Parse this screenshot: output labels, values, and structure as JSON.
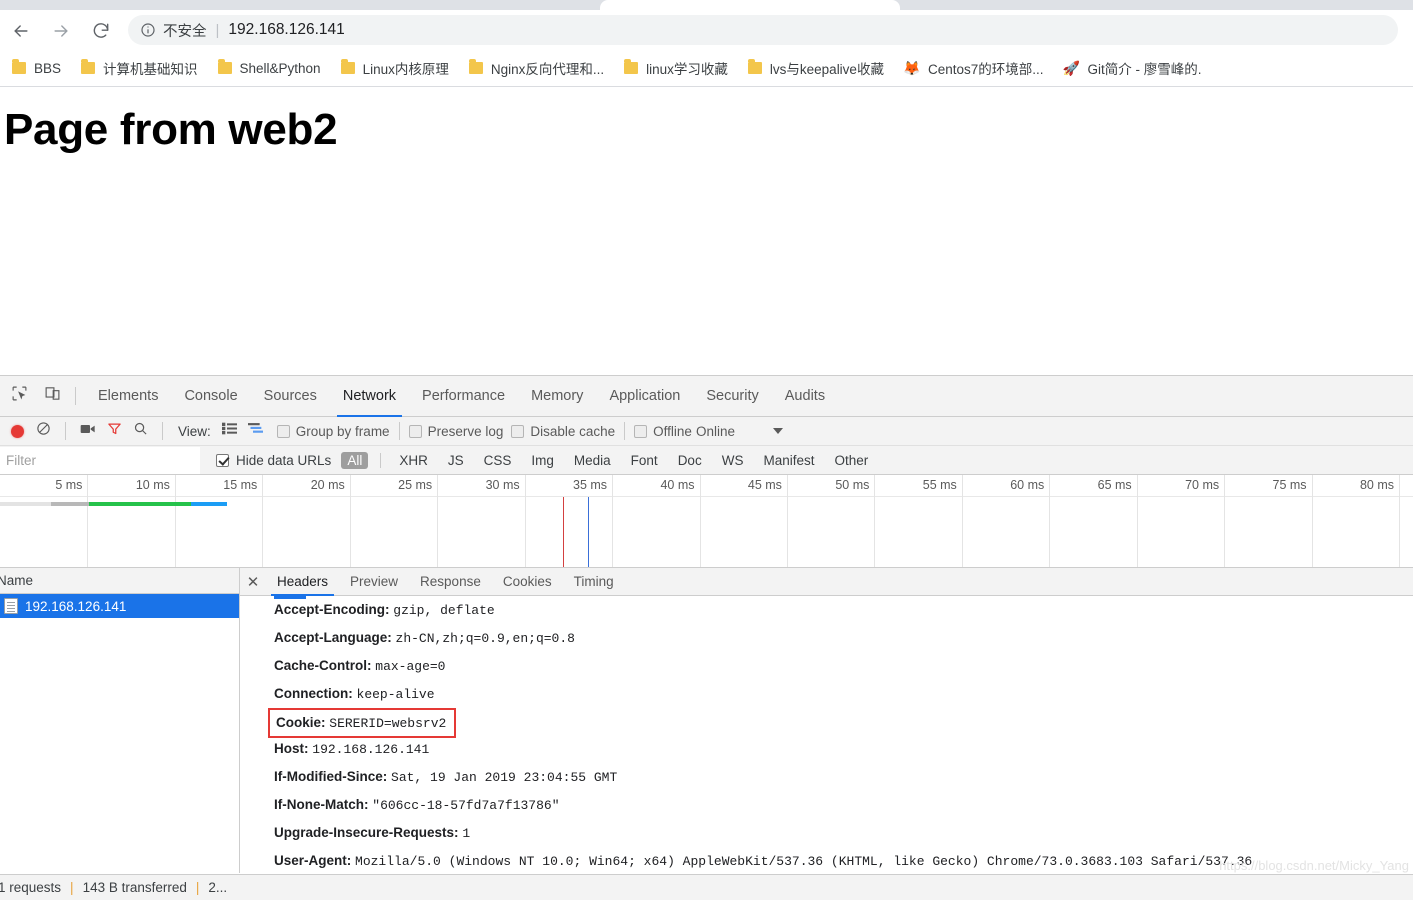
{
  "browser": {
    "nav": {
      "back_icon": "arrow-left-icon",
      "forward_icon": "arrow-right-icon",
      "reload_icon": "reload-icon"
    },
    "omnibox": {
      "info_icon": "info-circle-icon",
      "security_label": "不安全",
      "separator": "|",
      "url": "192.168.126.141"
    },
    "bookmarks": [
      {
        "label": "BBS",
        "icon": "folder-icon"
      },
      {
        "label": "计算机基础知识",
        "icon": "folder-icon"
      },
      {
        "label": "Shell&Python",
        "icon": "folder-icon"
      },
      {
        "label": "Linux内核原理",
        "icon": "folder-icon"
      },
      {
        "label": "Nginx反向代理和...",
        "icon": "folder-icon"
      },
      {
        "label": "linux学习收藏",
        "icon": "folder-icon"
      },
      {
        "label": "lvs与keepalive收藏",
        "icon": "folder-icon"
      },
      {
        "label": "Centos7的环境部...",
        "icon": "fox-icon"
      },
      {
        "label": "Git简介 - 廖雪峰的.",
        "icon": "rocket-icon"
      }
    ]
  },
  "page": {
    "heading": "Page from web2"
  },
  "devtools": {
    "left_icons": [
      {
        "name": "inspect-element-icon"
      },
      {
        "name": "device-toolbar-icon"
      }
    ],
    "tabs": [
      {
        "label": "Elements",
        "active": false
      },
      {
        "label": "Console",
        "active": false
      },
      {
        "label": "Sources",
        "active": false
      },
      {
        "label": "Network",
        "active": true
      },
      {
        "label": "Performance",
        "active": false
      },
      {
        "label": "Memory",
        "active": false
      },
      {
        "label": "Application",
        "active": false
      },
      {
        "label": "Security",
        "active": false
      },
      {
        "label": "Audits",
        "active": false
      }
    ],
    "toolbar": {
      "record_icon": "record-button-icon",
      "clear_icon": "clear-icon",
      "capture_screenshots_icon": "camera-icon",
      "filter_icon": "funnel-icon",
      "search_icon": "search-icon",
      "view_label": "View:",
      "view_list_icon": "list-view-icon",
      "view_waterfall_icon": "waterfall-view-icon",
      "group_by_frame": {
        "label": "Group by frame",
        "checked": false
      },
      "preserve_log": {
        "label": "Preserve log",
        "checked": false
      },
      "disable_cache": {
        "label": "Disable cache",
        "checked": false
      },
      "offline": {
        "label": "Offline",
        "checked": false
      },
      "throttling": "Online",
      "throttling_caret_icon": "chevron-down-icon"
    },
    "filterbar": {
      "filter_placeholder": "Filter",
      "filter_value": "",
      "hide_data_urls": {
        "label": "Hide data URLs",
        "checked": true
      },
      "types": [
        {
          "label": "All",
          "active": true
        },
        {
          "label": "XHR",
          "active": false
        },
        {
          "label": "JS",
          "active": false
        },
        {
          "label": "CSS",
          "active": false
        },
        {
          "label": "Img",
          "active": false
        },
        {
          "label": "Media",
          "active": false
        },
        {
          "label": "Font",
          "active": false
        },
        {
          "label": "Doc",
          "active": false
        },
        {
          "label": "WS",
          "active": false
        },
        {
          "label": "Manifest",
          "active": false
        },
        {
          "label": "Other",
          "active": false
        }
      ]
    },
    "timeline": {
      "unit": "ms",
      "ticks": [
        "5 ms",
        "10 ms",
        "15 ms",
        "20 ms",
        "25 ms",
        "30 ms",
        "35 ms",
        "40 ms",
        "45 ms",
        "50 ms",
        "55 ms",
        "60 ms",
        "65 ms",
        "70 ms",
        "75 ms",
        "80 ms"
      ],
      "event_lines": [
        {
          "name": "dom-content-loaded-line",
          "color": "#d34040",
          "at_ms": 32.2
        },
        {
          "name": "load-event-line",
          "color": "#3a6fd8",
          "at_ms": 33.6
        }
      ],
      "bar_segments": [
        {
          "name": "queueing",
          "color": "#e3e3e3",
          "start_ms": 0.0,
          "end_ms": 2.9
        },
        {
          "name": "stalled",
          "color": "#b8b8b8",
          "start_ms": 2.9,
          "end_ms": 5.1
        },
        {
          "name": "waiting-ttfb",
          "color": "#25c24a",
          "start_ms": 5.1,
          "end_ms": 10.9
        },
        {
          "name": "content-download",
          "color": "#1b9df5",
          "start_ms": 10.9,
          "end_ms": 13.0
        }
      ]
    },
    "requests": {
      "column_header": "Name",
      "rows": [
        {
          "name": "192.168.126.141",
          "icon": "document-icon",
          "selected": true
        }
      ]
    },
    "detail": {
      "close_icon": "close-icon",
      "tabs": [
        {
          "label": "Headers",
          "active": true
        },
        {
          "label": "Preview",
          "active": false
        },
        {
          "label": "Response",
          "active": false
        },
        {
          "label": "Cookies",
          "active": false
        },
        {
          "label": "Timing",
          "active": false
        }
      ],
      "headers": [
        {
          "name": "Accept-Encoding:",
          "value": "gzip, deflate",
          "highlighted": false
        },
        {
          "name": "Accept-Language:",
          "value": "zh-CN,zh;q=0.9,en;q=0.8",
          "highlighted": false
        },
        {
          "name": "Cache-Control:",
          "value": "max-age=0",
          "highlighted": false
        },
        {
          "name": "Connection:",
          "value": "keep-alive",
          "highlighted": false
        },
        {
          "name": "Cookie:",
          "value": "SERERID=websrv2",
          "highlighted": true
        },
        {
          "name": "Host:",
          "value": "192.168.126.141",
          "highlighted": false
        },
        {
          "name": "If-Modified-Since:",
          "value": "Sat, 19 Jan 2019 23:04:55 GMT",
          "highlighted": false
        },
        {
          "name": "If-None-Match:",
          "value": "\"606cc-18-57fd7a7f13786\"",
          "highlighted": false
        },
        {
          "name": "Upgrade-Insecure-Requests:",
          "value": "1",
          "highlighted": false
        },
        {
          "name": "User-Agent:",
          "value": "Mozilla/5.0 (Windows NT 10.0; Win64; x64) AppleWebKit/537.36 (KHTML, like Gecko) Chrome/73.0.3683.103 Safari/537.36",
          "highlighted": false
        }
      ]
    },
    "statusbar": {
      "requests": "1 requests",
      "transferred": "143 B transferred",
      "finish": "2...",
      "sep": "|"
    }
  },
  "watermark": "https://blog.csdn.net/Micky_Yang",
  "colors": {
    "accent": "#1a73e8",
    "highlight_box": "#e53935",
    "record": "#e53935",
    "ttfb": "#25c24a",
    "download": "#1b9df5"
  }
}
